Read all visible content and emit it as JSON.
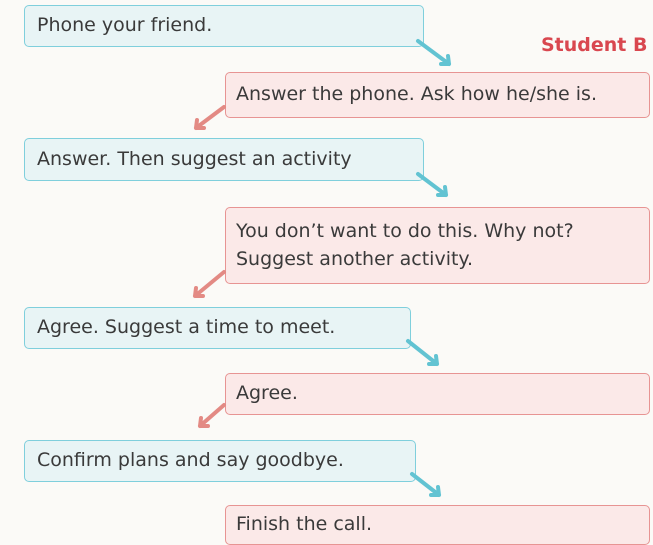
{
  "label_b": "Student B",
  "steps": [
    {
      "role": "A",
      "text": "Phone your friend."
    },
    {
      "role": "B",
      "text": "Answer the phone. Ask how he/she is."
    },
    {
      "role": "A",
      "text": "Answer. Then suggest an activity"
    },
    {
      "role": "B",
      "text": "You don’t want to do this. Why not? Suggest another activity."
    },
    {
      "role": "A",
      "text": "Agree. Suggest a time to meet."
    },
    {
      "role": "B",
      "text": "Agree."
    },
    {
      "role": "A",
      "text": "Confirm plans and say goodbye."
    },
    {
      "role": "B",
      "text": "Finish the call."
    }
  ],
  "colors": {
    "student_a_border": "#7fcfdc",
    "student_a_fill": "#e8f4f5",
    "student_b_border": "#e79493",
    "student_b_fill": "#fbe9e8",
    "label_b": "#d9474f"
  },
  "icons": [
    "arrow-down-right-icon",
    "arrow-down-left-icon"
  ]
}
